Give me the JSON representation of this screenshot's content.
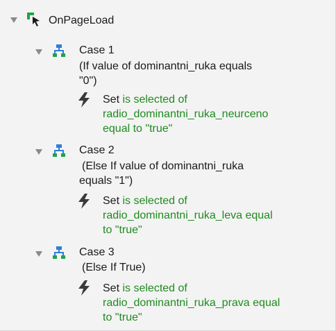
{
  "tree": {
    "root": {
      "label": "OnPageLoad"
    },
    "cases": [
      {
        "title": "Case 1",
        "condition_lines": [
          "(If value of dominantni_ruka equals",
          "\"0\")"
        ],
        "action": {
          "verb": "Set",
          "line1_green": "is selected of",
          "line2_green": "radio_dominantni_ruka_neurceno",
          "line3_green": "equal to \"true\""
        }
      },
      {
        "title": "Case 2",
        "condition_lines": [
          "(Else If value of dominantni_ruka",
          "equals \"1\")"
        ],
        "action": {
          "verb": "Set",
          "line1_green": "is selected of",
          "line2_green": "radio_dominantni_ruka_leva equal",
          "line3_green": "to \"true\""
        }
      },
      {
        "title": "Case 3",
        "condition_lines": [
          "(Else If True)"
        ],
        "action": {
          "verb": "Set",
          "line1_green": "is selected of",
          "line2_green": "radio_dominantni_ruka_prava equal",
          "line3_green": "to \"true\""
        }
      }
    ]
  },
  "colors": {
    "panel_bg": "#f3f3f3",
    "event_icon_green": "#1fa24a",
    "case_icon_blue": "#2f7fd6",
    "case_icon_green": "#1fa24a",
    "action_text_green": "#1f8a1f",
    "triangle_gray": "#8a8a8a",
    "lightning_dark": "#3a3a3a"
  },
  "icons": {
    "root": "event-cursor-icon",
    "case": "case-branch-icon",
    "action": "lightning-icon",
    "expander": "disclosure-triangle-icon"
  }
}
